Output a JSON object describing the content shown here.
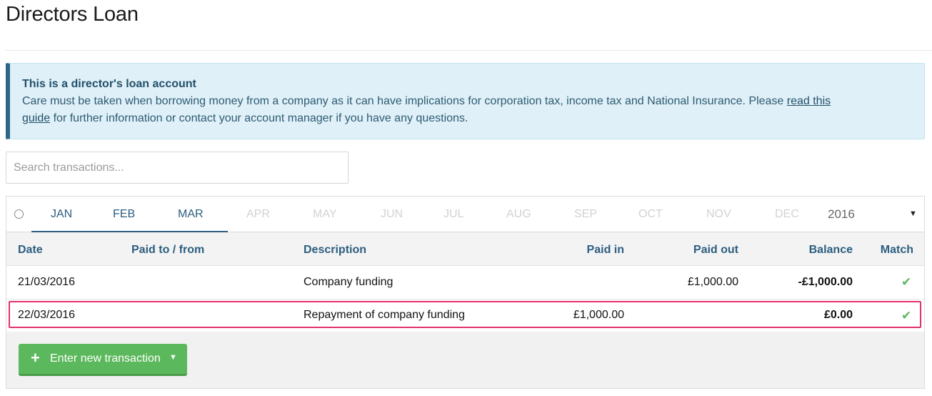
{
  "page": {
    "title": "Directors Loan"
  },
  "notice": {
    "title": "This is a director's loan account",
    "body_before": "Care must be taken when borrowing money from a company as it can have implications for corporation tax, income tax and National Insurance. Please ",
    "link_text": "read this guide",
    "body_after": " for further information or contact your account manager if you have any questions."
  },
  "search": {
    "placeholder": "Search transactions...",
    "value": ""
  },
  "months": {
    "items": [
      {
        "label": "JAN",
        "state": "active"
      },
      {
        "label": "FEB",
        "state": "active"
      },
      {
        "label": "MAR",
        "state": "active"
      },
      {
        "label": "APR",
        "state": "inactive"
      },
      {
        "label": "MAY",
        "state": "inactive"
      },
      {
        "label": "JUN",
        "state": "inactive"
      },
      {
        "label": "JUL",
        "state": "inactive"
      },
      {
        "label": "AUG",
        "state": "inactive"
      },
      {
        "label": "SEP",
        "state": "inactive"
      },
      {
        "label": "OCT",
        "state": "inactive"
      },
      {
        "label": "NOV",
        "state": "inactive"
      },
      {
        "label": "DEC",
        "state": "inactive"
      }
    ],
    "year": "2016",
    "year_dropdown_icon": "caret-down-icon"
  },
  "table": {
    "headers": {
      "date": "Date",
      "paid_to_from": "Paid to / from",
      "description": "Description",
      "paid_in": "Paid in",
      "paid_out": "Paid out",
      "balance": "Balance",
      "match": "Match"
    },
    "rows": [
      {
        "date": "21/03/2016",
        "paid_to_from": "",
        "description": "Company funding",
        "paid_in": "",
        "paid_out": "£1,000.00",
        "balance": "-£1,000.00",
        "match_icon": "checkmark-icon",
        "highlighted": false
      },
      {
        "date": "22/03/2016",
        "paid_to_from": "",
        "description": "Repayment of company funding",
        "paid_in": "£1,000.00",
        "paid_out": "",
        "balance": "£0.00",
        "match_icon": "checkmark-icon",
        "highlighted": true
      }
    ]
  },
  "actions": {
    "new_transaction_label": "Enter new transaction",
    "icon": "plus-icon"
  },
  "colors": {
    "accent": "#2c5e80",
    "notice_bg": "#dff0f8",
    "notice_border": "#2b6786",
    "success": "#5cb85c",
    "highlight": "#e3306e"
  }
}
